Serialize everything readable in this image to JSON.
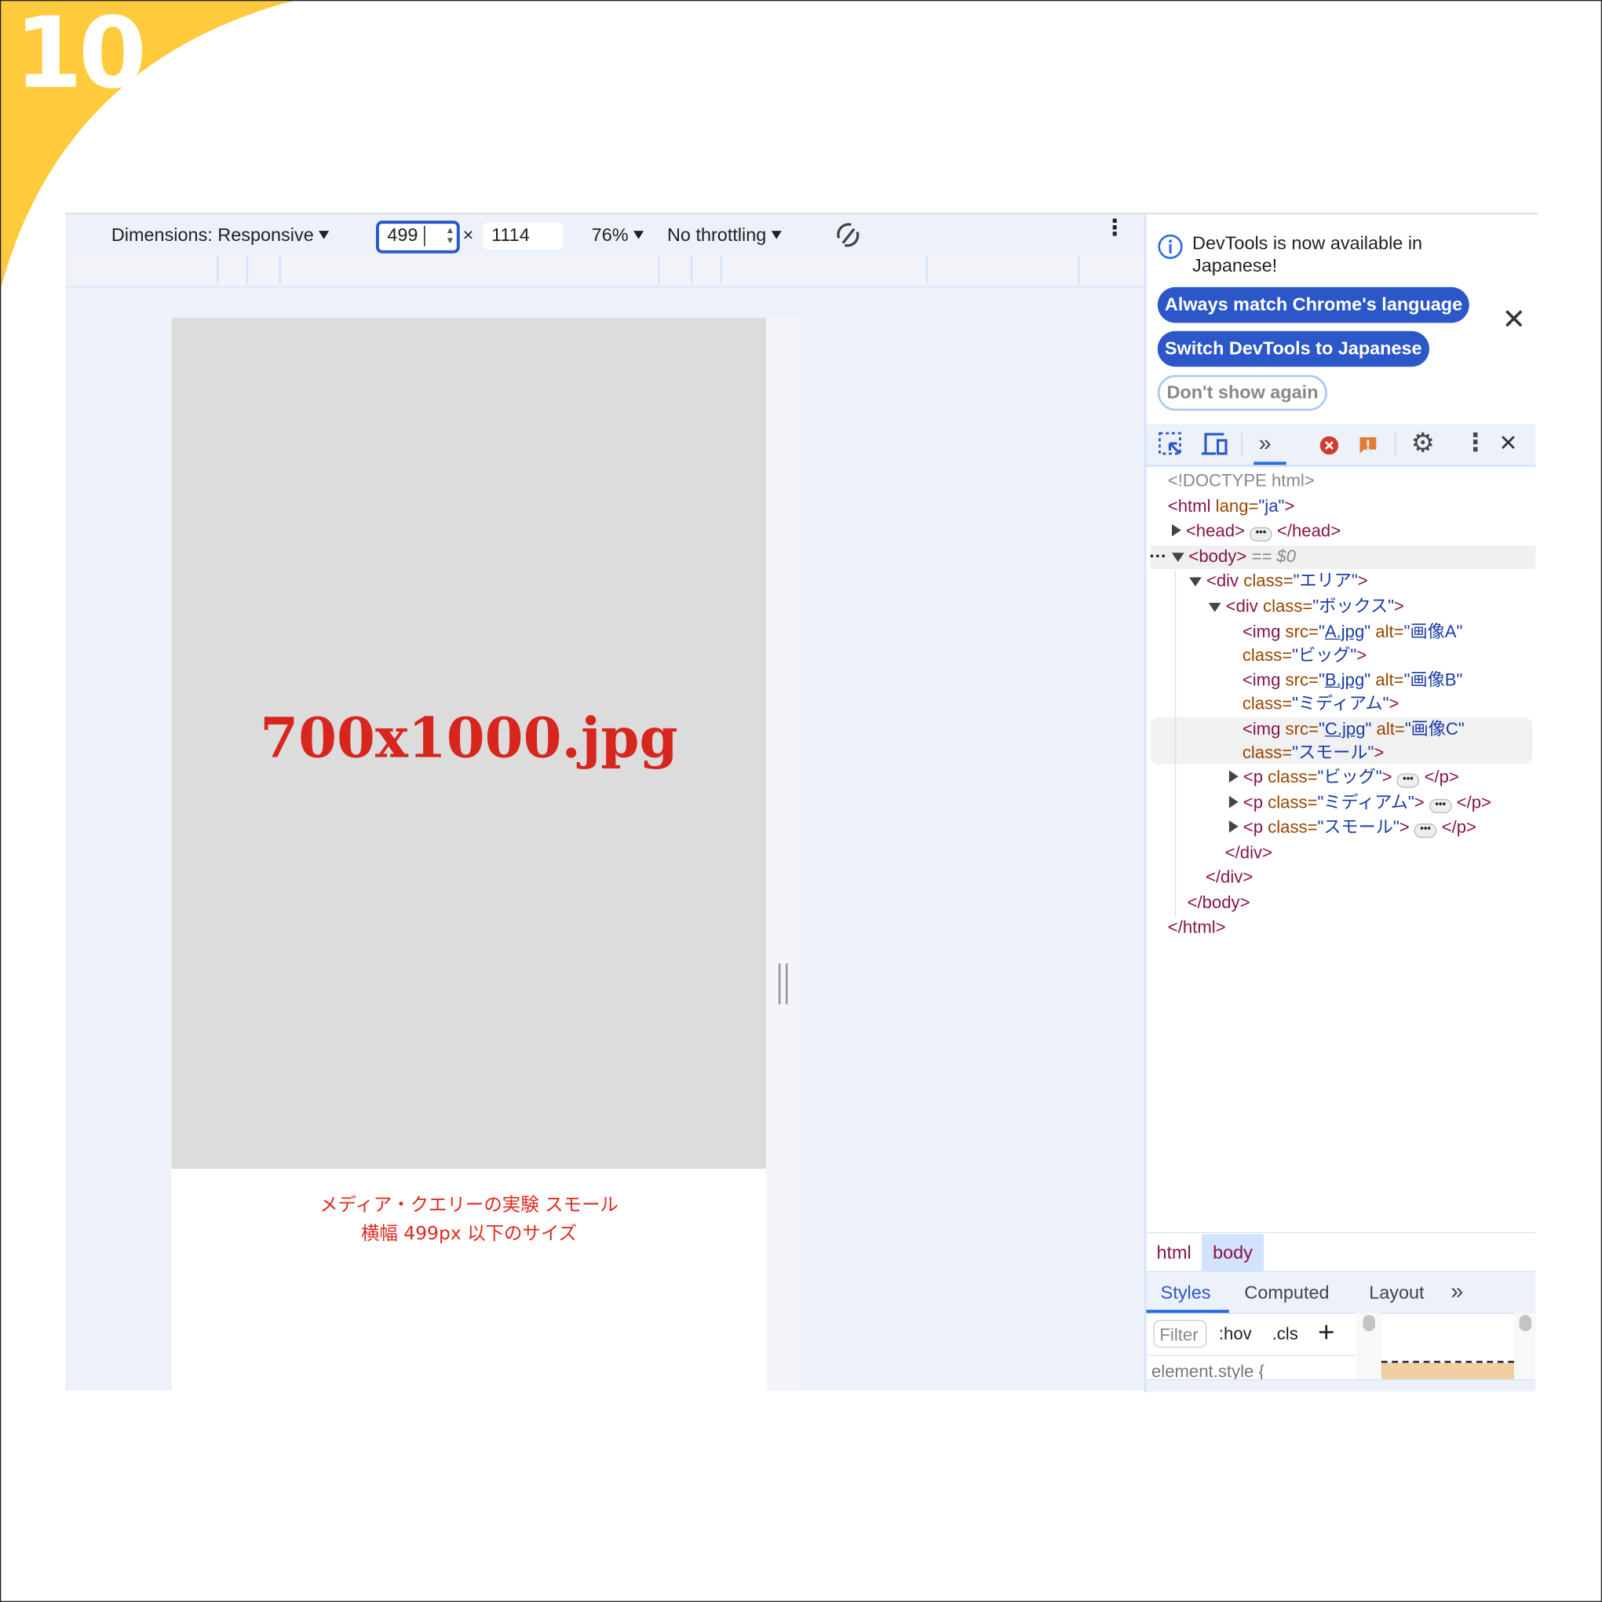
{
  "badge": {
    "number": "10",
    "color": "#ffcb3d"
  },
  "device_toolbar": {
    "dimensions_label": "Dimensions: Responsive",
    "width_value": "499",
    "height_value": "1114",
    "times": "×",
    "zoom": "76%",
    "throttling": "No throttling",
    "rotate_icon": "rotate-icon",
    "more_icon": "kebab-icon"
  },
  "viewport": {
    "image_text": "700x1000.jpg",
    "caption_line1": "メディア・クエリーの実験 スモール",
    "caption_line2": "横幅 499px 以下のサイズ"
  },
  "devtools": {
    "notice": {
      "line1": "DevTools is now available in",
      "line2": "Japanese!",
      "btn_match": "Always match Chrome's language",
      "btn_switch": "Switch DevTools to Japanese",
      "btn_dont": "Don't show again"
    },
    "toolbar": {
      "icons": [
        "inspect-icon",
        "device-toggle-icon",
        "more-tabs-icon",
        "error-icon",
        "warning-icon",
        "settings-icon",
        "kebab-icon",
        "close-icon"
      ]
    },
    "dom": {
      "doctype": "<!DOCTYPE html>",
      "html_open": "<html",
      "lang_attr": " lang=",
      "lang_val": "\"ja\"",
      "close_br": ">",
      "head_open": "<head>",
      "head_close": "</head>",
      "body_open": "<body>",
      "body_eq": "== $0",
      "div_open": "<div",
      "class_attr": " class=",
      "area_val": "\"エリア\"",
      "box_val": "\"ボックス\"",
      "img_open": "<img",
      "src_attr": " src=",
      "alt_attr": " alt=",
      "class_attr2": "class=",
      "quote": "\"",
      "imgs": [
        {
          "src": "A.jpg",
          "alt": "\"画像A\"",
          "cls": "\"ビッグ\""
        },
        {
          "src": "B.jpg",
          "alt": "\"画像B\"",
          "cls": "\"ミディアム\""
        },
        {
          "src": "C.jpg",
          "alt": "\"画像C\"",
          "cls": "\"スモール\""
        }
      ],
      "p_open": "<p",
      "p_close": "</p>",
      "ps": [
        "\"ビッグ\"",
        "\"ミディアム\"",
        "\"スモール\""
      ],
      "div_close": "</div>",
      "body_close": "</body>",
      "html_close": "</html>"
    },
    "breadcrumbs": [
      "html",
      "body"
    ],
    "tabs": [
      "Styles",
      "Computed",
      "Layout"
    ],
    "filter_placeholder": "Filter",
    "hov": ":hov",
    "cls": ".cls",
    "element_style": "element.style {"
  }
}
